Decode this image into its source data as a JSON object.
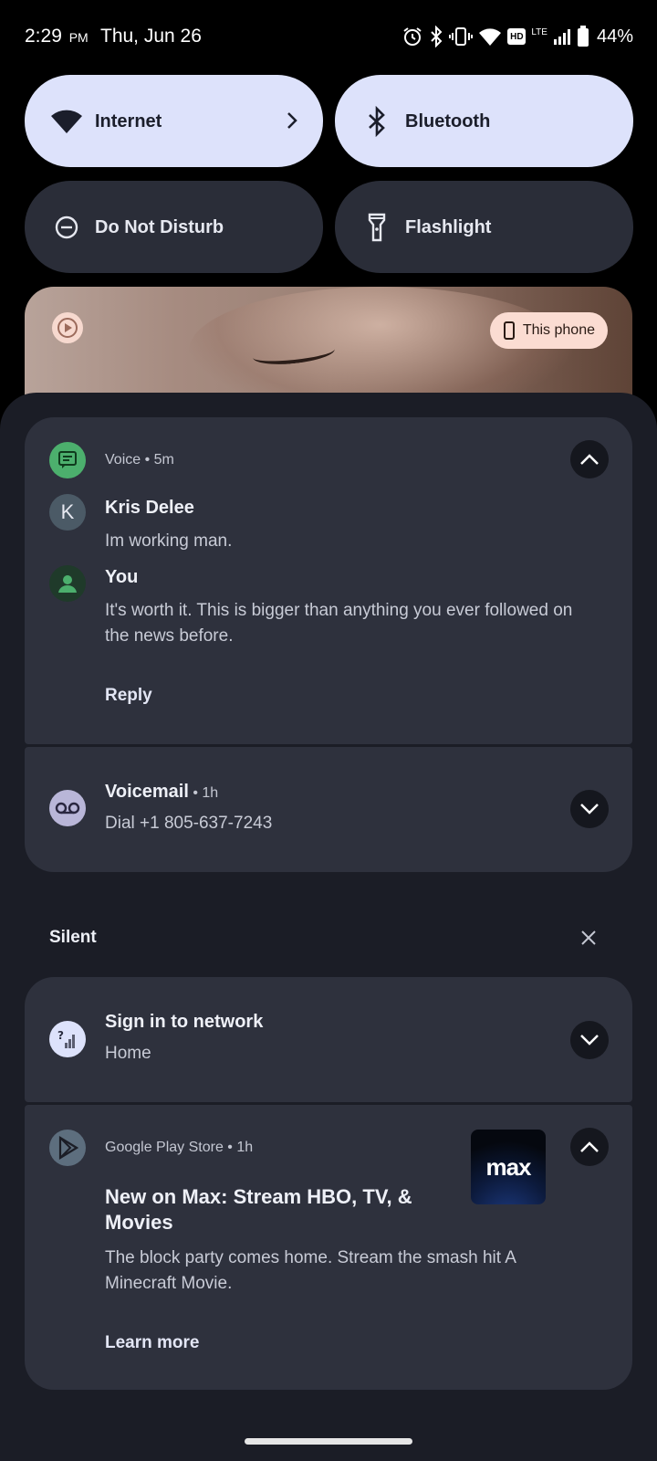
{
  "status_bar": {
    "time": "2:29",
    "ampm": "PM",
    "date": "Thu, Jun 26",
    "network_label": "LTE",
    "hd_label": "HD",
    "battery": "44%",
    "icons": [
      "alarm-icon",
      "bluetooth-icon",
      "vibrate-icon",
      "wifi-icon",
      "hd-icon",
      "lte-icon",
      "signal-icon",
      "battery-icon"
    ]
  },
  "quick_settings": {
    "tiles": [
      {
        "label": "Internet",
        "state": "on",
        "icon": "wifi-icon"
      },
      {
        "label": "Bluetooth",
        "state": "on",
        "icon": "bluetooth-icon"
      },
      {
        "label": "Do Not Disturb",
        "state": "off",
        "icon": "dnd-icon"
      },
      {
        "label": "Flashlight",
        "state": "off",
        "icon": "flashlight-icon"
      }
    ]
  },
  "media": {
    "output_label": "This phone"
  },
  "notifications": {
    "voice": {
      "app": "Voice",
      "time": "5m",
      "messages": [
        {
          "sender": "Kris Delee",
          "avatar_letter": "K",
          "text": "Im working man."
        },
        {
          "sender": "You",
          "text1": "It's worth it. This is bigger than anything you ever followed on",
          "text2": "the news before."
        }
      ],
      "action": "Reply"
    },
    "voicemail": {
      "title": "Voicemail",
      "time": "1h",
      "text": "Dial +1 805-637-7243"
    },
    "silent_section": {
      "label": "Silent"
    },
    "network": {
      "title": "Sign in to network",
      "text": "Home"
    },
    "play_store": {
      "app": "Google Play Store",
      "time": "1h",
      "title1": "New on Max: Stream HBO, TV, &",
      "title2": "Movies",
      "body1": "The block party comes home. Stream the smash hit A",
      "body2": "Minecraft Movie.",
      "thumb_logo": "max",
      "action": "Learn more"
    }
  },
  "colors": {
    "tile_on": "#dde2fb",
    "tile_off": "#2a2d38",
    "shade_bg": "#1b1d26",
    "card_bg": "#2e313d",
    "voice_green": "#4caf6d"
  }
}
